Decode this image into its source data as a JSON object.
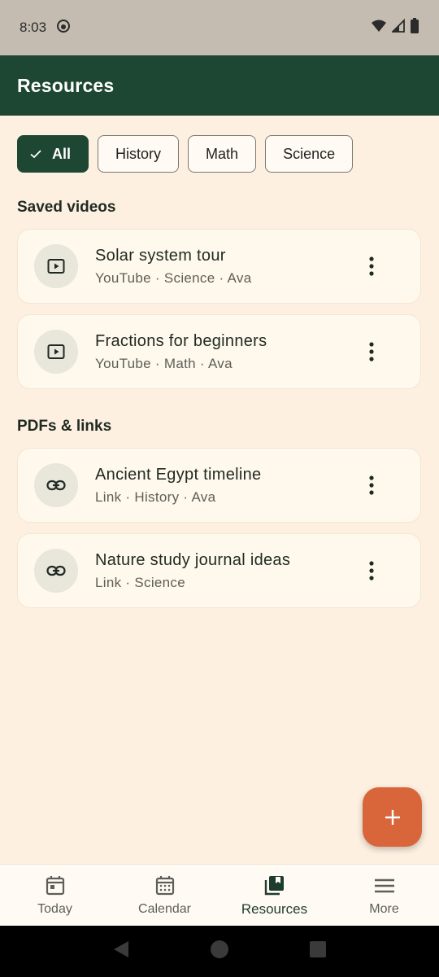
{
  "status_bar": {
    "time": "8:03"
  },
  "app_bar": {
    "title": "Resources"
  },
  "filters": [
    {
      "label": "All",
      "selected": true
    },
    {
      "label": "History",
      "selected": false
    },
    {
      "label": "Math",
      "selected": false
    },
    {
      "label": "Science",
      "selected": false
    }
  ],
  "sections": {
    "videos": {
      "title": "Saved videos",
      "items": [
        {
          "title": "Solar system tour",
          "subtitle": "YouTube · Science · Ava",
          "icon": "play-icon"
        },
        {
          "title": "Fractions for beginners",
          "subtitle": "YouTube · Math · Ava",
          "icon": "play-icon"
        }
      ]
    },
    "links": {
      "title": "PDFs & links",
      "items": [
        {
          "title": "Ancient Egypt timeline",
          "subtitle": "Link · History · Ava",
          "icon": "link-icon"
        },
        {
          "title": "Nature study journal ideas",
          "subtitle": "Link · Science",
          "icon": "link-icon"
        }
      ]
    }
  },
  "bottom_nav": [
    {
      "label": "Today",
      "icon": "calendar-today-icon",
      "active": false
    },
    {
      "label": "Calendar",
      "icon": "calendar-month-icon",
      "active": false
    },
    {
      "label": "Resources",
      "icon": "library-icon",
      "active": true
    },
    {
      "label": "More",
      "icon": "menu-icon",
      "active": false
    }
  ],
  "colors": {
    "primary": "#1e4733",
    "background": "#fdf0e1",
    "card": "#fff8ec",
    "fab": "#d9663a"
  }
}
